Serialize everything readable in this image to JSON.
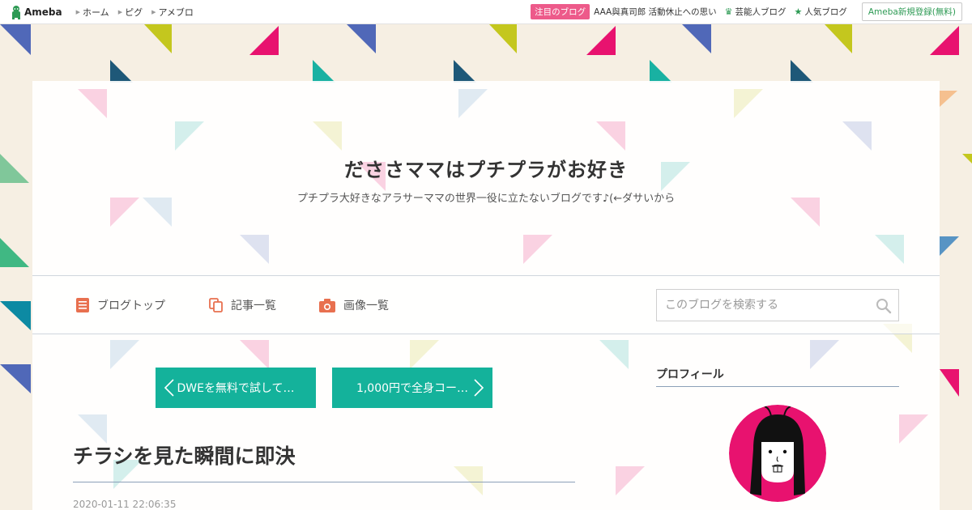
{
  "topbar": {
    "logo_text": "Ameba",
    "nav": [
      {
        "label": "ホーム"
      },
      {
        "label": "ピグ"
      },
      {
        "label": "アメブロ"
      }
    ],
    "attention_badge": "注目のブログ",
    "attention_text": "AAA與真司郎 活動休止への思い",
    "celebrity_link": "芸能人ブログ",
    "popular_link": "人気ブログ",
    "signup_button": "Ameba新規登録(無料)"
  },
  "header": {
    "title": "だささママはプチプラがお好き",
    "description": "プチプラ大好きなアラサーママの世界一役に立たないブログです♪(←ダサいから"
  },
  "blog_nav": {
    "items": [
      {
        "label": "ブログトップ",
        "icon": "document-icon"
      },
      {
        "label": "記事一覧",
        "icon": "copy-icon"
      },
      {
        "label": "画像一覧",
        "icon": "camera-icon"
      }
    ],
    "search_placeholder": "このブログを検索する"
  },
  "pager": {
    "prev_label": "DWEを無料で試して…",
    "next_label": "1,000円で全身コー…"
  },
  "article": {
    "title": "チラシを見た瞬間に即決",
    "date": "2020-01-11 22:06:35"
  },
  "sidebar": {
    "profile_heading": "プロフィール"
  },
  "colors": {
    "accent_teal": "#14b29b",
    "attention_pink": "#ed5a8a",
    "ameba_green": "#2d9a54",
    "avatar_bg": "#e8126f"
  }
}
